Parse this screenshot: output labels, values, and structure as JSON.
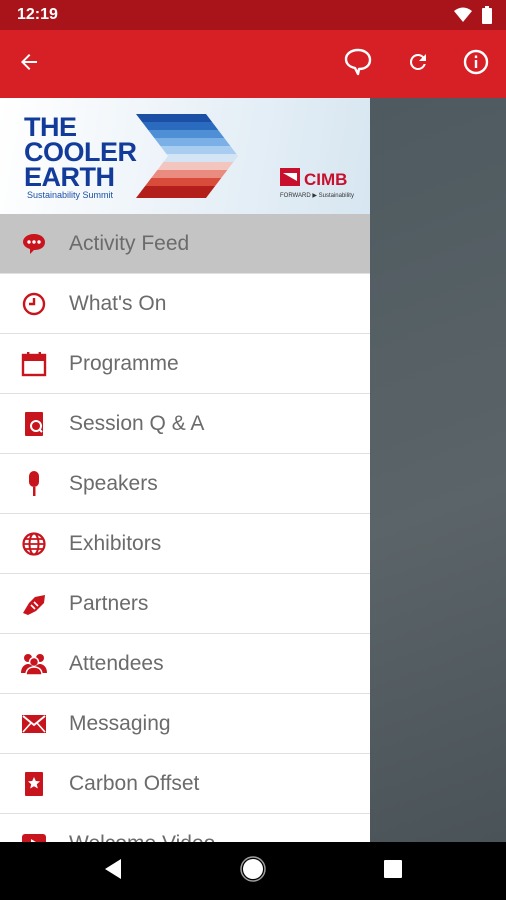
{
  "status_bar": {
    "time": "12:19",
    "icons": [
      "wifi-icon",
      "battery-icon"
    ]
  },
  "app_bar": {
    "icons": [
      "back-arrow-icon",
      "chat-bubble-icon",
      "refresh-icon",
      "info-icon"
    ]
  },
  "banner": {
    "title_lines": [
      "THE",
      "COOLER",
      "EARTH"
    ],
    "subtitle": "Sustainability Summit",
    "sponsor": "CIMB",
    "sponsor_tagline": "FORWARD ▶ Sustainability"
  },
  "menu": {
    "items": [
      {
        "label": "Activity Feed",
        "icon": "chat-bubble-icon"
      },
      {
        "label": "What's On",
        "icon": "clock-icon"
      },
      {
        "label": "Programme",
        "icon": "calendar-icon"
      },
      {
        "label": "Session Q & A",
        "icon": "qa-icon"
      },
      {
        "label": "Speakers",
        "icon": "microphone-icon"
      },
      {
        "label": "Exhibitors",
        "icon": "globe-icon"
      },
      {
        "label": "Partners",
        "icon": "handshake-icon"
      },
      {
        "label": "Attendees",
        "icon": "people-icon"
      },
      {
        "label": "Messaging",
        "icon": "envelope-icon"
      },
      {
        "label": "Carbon Offset",
        "icon": "badge-icon"
      },
      {
        "label": "Welcome Video",
        "icon": "video-icon"
      }
    ]
  },
  "colors": {
    "primary": "#d71f26",
    "status_bar": "#a81419",
    "active_row": "#c4c4c4",
    "label": "#6b6b6b"
  }
}
